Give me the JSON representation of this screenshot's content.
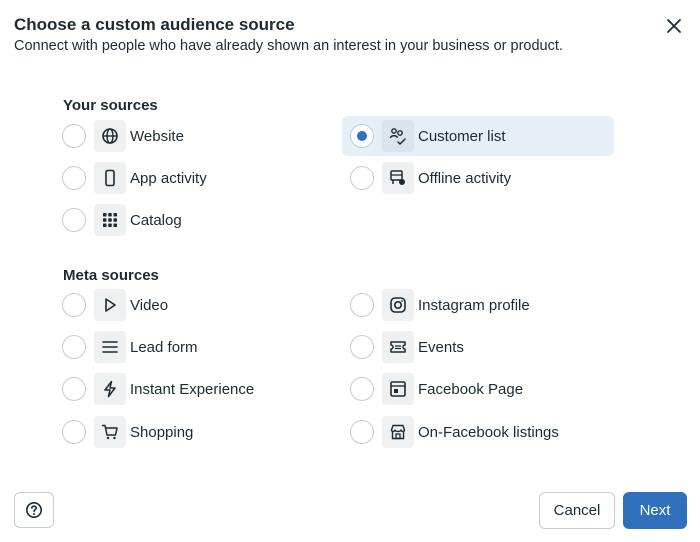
{
  "dialog": {
    "title": "Choose a custom audience source",
    "subtitle": "Connect with people who have already shown an interest in your business or product."
  },
  "your_sources": {
    "heading": "Your sources",
    "options": [
      {
        "label": "Website",
        "icon": "globe-icon",
        "selected": false
      },
      {
        "label": "Customer list",
        "icon": "customer-list-icon",
        "selected": true
      },
      {
        "label": "App activity",
        "icon": "mobile-phone-icon",
        "selected": false
      },
      {
        "label": "Offline activity",
        "icon": "offline-store-icon",
        "selected": false
      },
      {
        "label": "Catalog",
        "icon": "grid-icon",
        "selected": false
      }
    ]
  },
  "meta_sources": {
    "heading": "Meta sources",
    "options": [
      {
        "label": "Video",
        "icon": "play-icon",
        "selected": false
      },
      {
        "label": "Instagram profile",
        "icon": "instagram-icon",
        "selected": false
      },
      {
        "label": "Lead form",
        "icon": "lines-icon",
        "selected": false
      },
      {
        "label": "Events",
        "icon": "ticket-icon",
        "selected": false
      },
      {
        "label": "Instant Experience",
        "icon": "lightning-icon",
        "selected": false
      },
      {
        "label": "Facebook Page",
        "icon": "page-icon",
        "selected": false
      },
      {
        "label": "Shopping",
        "icon": "shopping-cart-icon",
        "selected": false
      },
      {
        "label": "On-Facebook listings",
        "icon": "storefront-icon",
        "selected": false
      }
    ]
  },
  "footer": {
    "cancel_label": "Cancel",
    "next_label": "Next"
  },
  "colors": {
    "primary": "#2f6fbc",
    "selected_bg": "#e6eef6",
    "text": "#1c2b33"
  }
}
